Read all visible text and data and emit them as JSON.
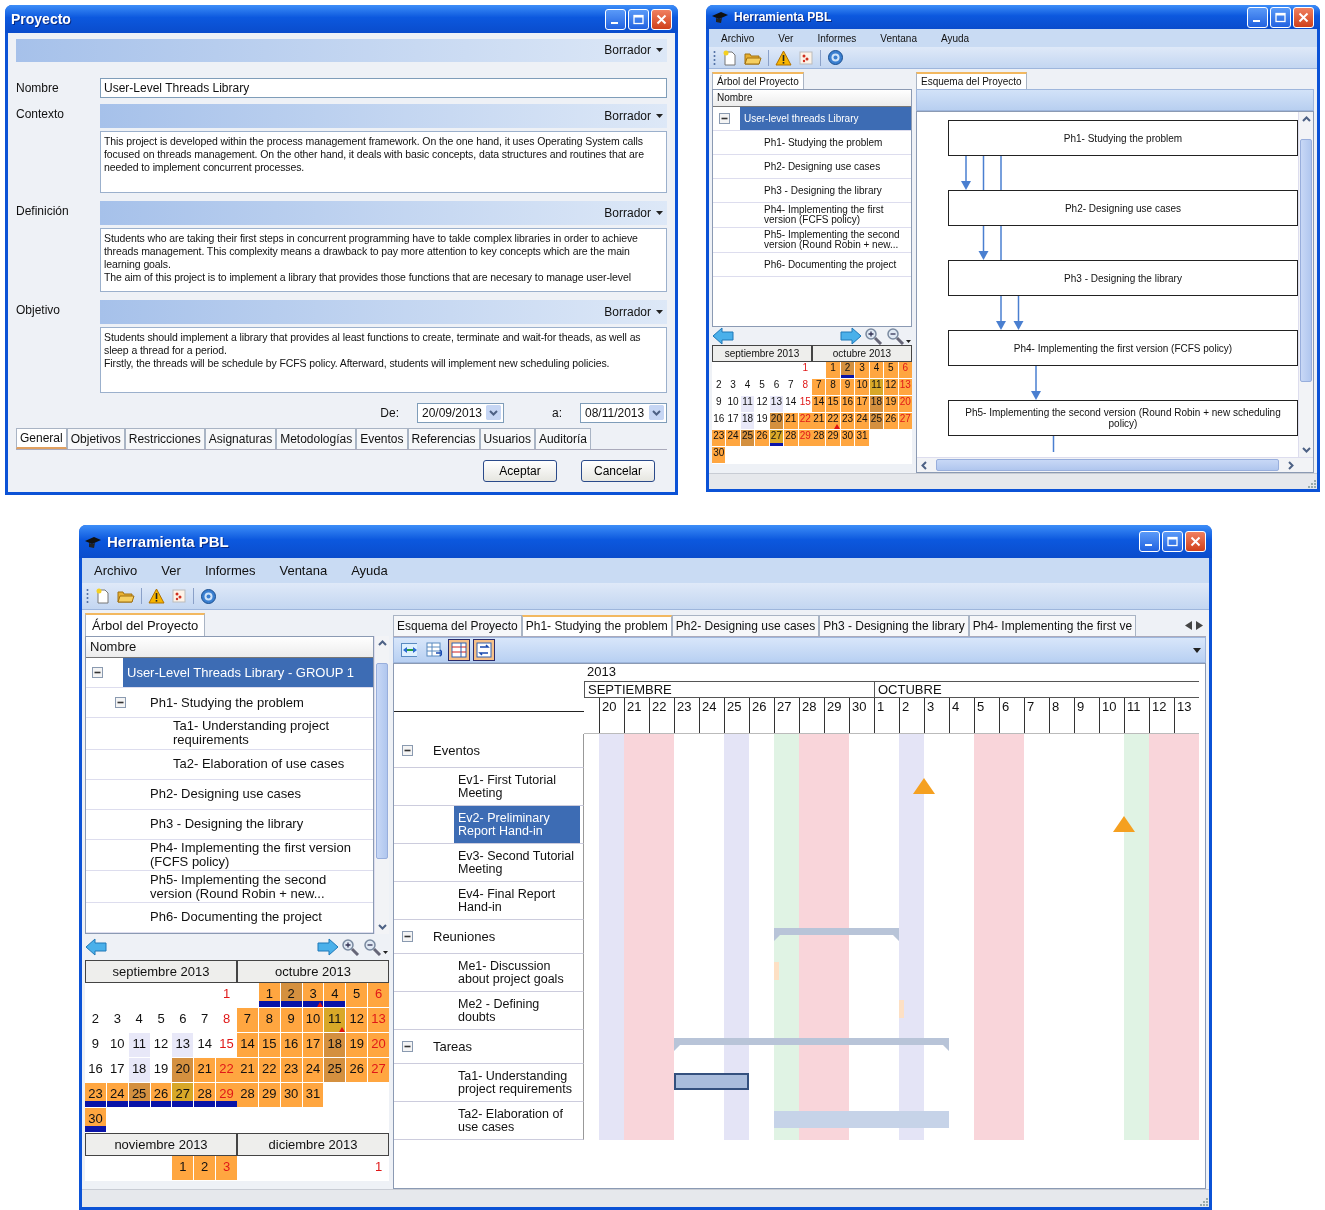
{
  "project_dialog": {
    "title": "Proyecto",
    "status": "Borrador",
    "fields": [
      {
        "kind": "input",
        "label": "Nombre",
        "value": "User-Level Threads Library"
      },
      {
        "kind": "text",
        "label": "Contexto",
        "status": "Borrador",
        "paragraphs": [
          "This project is developed within the process management framework. On the one hand, it uses Operating System calls focused on threads management. On the other hand, it deals with basic concepts, data structures and routines that are needed to implement concurrent processes."
        ]
      },
      {
        "kind": "text",
        "label": "Definición",
        "status": "Borrador",
        "paragraphs": [
          "Students who are taking their first steps in concurrent programming have to takle complex libraries in order to achieve threads management. This complexity means a drawback to pay more attention to key concepts which are the main learning goals.",
          "The aim of this project is to implement a library that provides those functions that are necesary to manage user-level"
        ]
      },
      {
        "kind": "text",
        "label": "Objetivo",
        "status": "Borrador",
        "paragraphs": [
          "Students should implement a library that provides al least functions to create, terminate and wait-for theads, as well as sleep a thread for a period.",
          "Firstly, the threads will be schedule by FCFS policy. Afterward, students will implement new scheduling policies."
        ]
      }
    ],
    "date_from": {
      "label": "De:",
      "value": "20/09/2013"
    },
    "date_to": {
      "label": "a:",
      "value": "08/11/2013"
    },
    "tabs": [
      {
        "label": "General",
        "selected": true
      },
      {
        "label": "Objetivos",
        "selected": false
      },
      {
        "label": "Restricciones",
        "selected": false
      },
      {
        "label": "Asignaturas",
        "selected": false
      },
      {
        "label": "Metodologías",
        "selected": false
      },
      {
        "label": "Eventos",
        "selected": false
      },
      {
        "label": "Referencias",
        "selected": false
      },
      {
        "label": "Usuarios",
        "selected": false
      },
      {
        "label": "Auditoría",
        "selected": false
      }
    ],
    "buttons": [
      "Aceptar",
      "Cancelar"
    ]
  },
  "tool_window": {
    "title": "Herramienta PBL",
    "menu": [
      "Archivo",
      "Ver",
      "Informes",
      "Ventana",
      "Ayuda"
    ],
    "tree_tab": "Árbol del Proyecto",
    "tree_header": "Nombre",
    "tree": [
      {
        "label": "User-level threads Library",
        "selected": true,
        "expanded": true,
        "children": [
          {
            "label": "Ph1-  Studying the problem",
            "selected": false
          },
          {
            "label": "Ph2- Designing use cases",
            "selected": false
          },
          {
            "label": "Ph3 - Designing the library",
            "selected": false
          },
          {
            "label": "Ph4- Implementing the first version (FCFS policy)",
            "selected": false
          },
          {
            "label": "Ph5- Implementing the second version (Round Robin + new...",
            "selected": false
          },
          {
            "label": "Ph6- Documenting the project",
            "selected": false
          }
        ]
      }
    ],
    "calendar": [
      {
        "title": "septiembre 2013",
        "weeks": [
          [
            {
              "kind": "empty"
            },
            {
              "kind": "empty"
            },
            {
              "kind": "empty"
            },
            {
              "kind": "empty"
            },
            {
              "kind": "empty"
            },
            {
              "kind": "empty"
            },
            {
              "day": "1",
              "kind": "sunday",
              "color": "#ffffff",
              "bar": false,
              "flag": false
            }
          ],
          [
            {
              "day": "2",
              "kind": "weekday",
              "color": "#ffffff",
              "bar": false,
              "flag": false
            },
            {
              "day": "3",
              "kind": "weekday",
              "color": "#ffffff",
              "bar": false,
              "flag": false
            },
            {
              "day": "4",
              "kind": "weekday",
              "color": "#ffffff",
              "bar": false,
              "flag": false
            },
            {
              "day": "5",
              "kind": "weekday",
              "color": "#ffffff",
              "bar": false,
              "flag": false
            },
            {
              "day": "6",
              "kind": "weekday",
              "color": "#ffffff",
              "bar": false,
              "flag": false
            },
            {
              "day": "7",
              "kind": "weekday",
              "color": "#ffffff",
              "bar": false,
              "flag": false
            },
            {
              "day": "8",
              "kind": "sunday",
              "color": "#ffffff",
              "bar": false,
              "flag": false
            }
          ],
          [
            {
              "day": "9",
              "kind": "weekday",
              "color": "#ffffff",
              "bar": false,
              "flag": false
            },
            {
              "day": "10",
              "kind": "weekday",
              "color": "#ffffff",
              "bar": false,
              "flag": false
            },
            {
              "day": "11",
              "kind": "weekday",
              "color": "#e8e8f8",
              "bar": false,
              "flag": false
            },
            {
              "day": "12",
              "kind": "weekday",
              "color": "#ffffff",
              "bar": false,
              "flag": false
            },
            {
              "day": "13",
              "kind": "weekday",
              "color": "#e8e8f8",
              "bar": false,
              "flag": false
            },
            {
              "day": "14",
              "kind": "weekday",
              "color": "#ffffff",
              "bar": false,
              "flag": false
            },
            {
              "day": "15",
              "kind": "sunday",
              "color": "#ffffff",
              "bar": false,
              "flag": false
            }
          ],
          [
            {
              "day": "16",
              "kind": "weekday",
              "color": "#ffffff",
              "bar": false,
              "flag": false
            },
            {
              "day": "17",
              "kind": "weekday",
              "color": "#ffffff",
              "bar": false,
              "flag": false
            },
            {
              "day": "18",
              "kind": "weekday",
              "color": "#e8e8f8",
              "bar": false,
              "flag": false
            },
            {
              "day": "19",
              "kind": "weekday",
              "color": "#ffffff",
              "bar": false,
              "flag": false
            },
            {
              "day": "20",
              "kind": "weekday",
              "color": "#d4903f",
              "bar": false,
              "flag": false
            },
            {
              "day": "21",
              "kind": "weekday",
              "color": "#ffa640",
              "bar": false,
              "flag": false
            },
            {
              "day": "22",
              "kind": "sunday",
              "color": "#ffa640",
              "bar": false,
              "flag": false
            }
          ],
          [
            {
              "day": "23",
              "kind": "weekday",
              "color": "#ffa640",
              "bar": false,
              "flag": false
            },
            {
              "day": "24",
              "kind": "weekday",
              "color": "#ffa640",
              "bar": false,
              "flag": false
            },
            {
              "day": "25",
              "kind": "weekday",
              "color": "#d4903f",
              "bar": false,
              "flag": false
            },
            {
              "day": "26",
              "kind": "weekday",
              "color": "#ffa640",
              "bar": false,
              "flag": false
            },
            {
              "day": "27",
              "kind": "weekday",
              "color": "#d8a828",
              "bar": true,
              "flag": false
            },
            {
              "day": "28",
              "kind": "weekday",
              "color": "#ffa640",
              "bar": false,
              "flag": false
            },
            {
              "day": "29",
              "kind": "sunday",
              "color": "#ffa640",
              "bar": false,
              "flag": false
            }
          ],
          [
            {
              "day": "30",
              "kind": "weekday",
              "color": "#ffa640",
              "bar": false,
              "flag": false
            }
          ]
        ]
      },
      {
        "title": "octubre 2013",
        "weeks": [
          [
            {
              "kind": "empty"
            },
            {
              "day": "1",
              "kind": "weekday",
              "color": "#ffa640",
              "bar": false,
              "flag": false
            },
            {
              "day": "2",
              "kind": "weekday",
              "color": "#d4903f",
              "bar": true,
              "flag": false
            },
            {
              "day": "3",
              "kind": "weekday",
              "color": "#ffa640",
              "bar": false,
              "flag": false
            },
            {
              "day": "4",
              "kind": "weekday",
              "color": "#ffa640",
              "bar": false,
              "flag": false
            },
            {
              "day": "5",
              "kind": "weekday",
              "color": "#ffa640",
              "bar": false,
              "flag": false
            },
            {
              "day": "6",
              "kind": "sunday",
              "color": "#ffa640",
              "bar": false,
              "flag": false
            }
          ],
          [
            {
              "day": "7",
              "kind": "weekday",
              "color": "#ffa640",
              "bar": false,
              "flag": false
            },
            {
              "day": "8",
              "kind": "weekday",
              "color": "#ffa640",
              "bar": false,
              "flag": false
            },
            {
              "day": "9",
              "kind": "weekday",
              "color": "#ffa640",
              "bar": false,
              "flag": false
            },
            {
              "day": "10",
              "kind": "weekday",
              "color": "#ffa640",
              "bar": false,
              "flag": false
            },
            {
              "day": "11",
              "kind": "weekday",
              "color": "#d8a828",
              "bar": false,
              "flag": false
            },
            {
              "day": "12",
              "kind": "weekday",
              "color": "#ffa640",
              "bar": false,
              "flag": false
            },
            {
              "day": "13",
              "kind": "sunday",
              "color": "#ffa640",
              "bar": false,
              "flag": false
            }
          ],
          [
            {
              "day": "14",
              "kind": "weekday",
              "color": "#ffa640",
              "bar": false,
              "flag": false
            },
            {
              "day": "15",
              "kind": "weekday",
              "color": "#ffa640",
              "bar": false,
              "flag": false
            },
            {
              "day": "16",
              "kind": "weekday",
              "color": "#ffa640",
              "bar": false,
              "flag": false
            },
            {
              "day": "17",
              "kind": "weekday",
              "color": "#ffa640",
              "bar": false,
              "flag": false
            },
            {
              "day": "18",
              "kind": "weekday",
              "color": "#d4903f",
              "bar": false,
              "flag": false
            },
            {
              "day": "19",
              "kind": "weekday",
              "color": "#ffa640",
              "bar": false,
              "flag": false
            },
            {
              "day": "20",
              "kind": "sunday",
              "color": "#ffa640",
              "bar": false,
              "flag": false
            }
          ],
          [
            {
              "day": "21",
              "kind": "weekday",
              "color": "#ffa640",
              "bar": false,
              "flag": false
            },
            {
              "day": "22",
              "kind": "weekday",
              "color": "#ffa640",
              "bar": false,
              "flag": true
            },
            {
              "day": "23",
              "kind": "weekday",
              "color": "#ffa640",
              "bar": false,
              "flag": false
            },
            {
              "day": "24",
              "kind": "weekday",
              "color": "#ffa640",
              "bar": false,
              "flag": false
            },
            {
              "day": "25",
              "kind": "weekday",
              "color": "#d4903f",
              "bar": false,
              "flag": false
            },
            {
              "day": "26",
              "kind": "weekday",
              "color": "#ffa640",
              "bar": false,
              "flag": false
            },
            {
              "day": "27",
              "kind": "sunday",
              "color": "#ffa640",
              "bar": false,
              "flag": false
            }
          ],
          [
            {
              "day": "28",
              "kind": "weekday",
              "color": "#ffa640",
              "bar": false,
              "flag": false
            },
            {
              "day": "29",
              "kind": "weekday",
              "color": "#ffa640",
              "bar": false,
              "flag": false
            },
            {
              "day": "30",
              "kind": "weekday",
              "color": "#ffa640",
              "bar": false,
              "flag": false
            },
            {
              "day": "31",
              "kind": "weekday",
              "color": "#ffa640",
              "bar": false,
              "flag": false
            }
          ]
        ]
      }
    ],
    "diagram_tab": "Esquema del Proyecto",
    "diagram": {
      "nodes": [
        "Ph1-  Studying the problem",
        "Ph2- Designing use cases",
        "Ph3 - Designing the library",
        "Ph4- Implementing the first version (FCFS policy)",
        "Ph5- Implementing the second version (Round Robin + new scheduling policy)"
      ]
    }
  },
  "main_window": {
    "title": "Herramienta PBL",
    "menu": [
      "Archivo",
      "Ver",
      "Informes",
      "Ventana",
      "Ayuda"
    ],
    "tree_tab": "Árbol del Proyecto",
    "tree_header": "Nombre",
    "tree": [
      {
        "label": "User-Level Threads Library - GROUP 1",
        "selected": true,
        "expanded": true,
        "children": [
          {
            "label": "Ph1-  Studying the problem",
            "selected": false,
            "expanded": true,
            "children": [
              {
                "label": "Ta1- Understanding project requirements",
                "selected": false
              },
              {
                "label": "Ta2- Elaboration of use cases",
                "selected": false
              }
            ]
          },
          {
            "label": "Ph2- Designing use cases",
            "selected": false
          },
          {
            "label": "Ph3 - Designing the library",
            "selected": false
          },
          {
            "label": "Ph4- Implementing the first version (FCFS policy)",
            "selected": false
          },
          {
            "label": "Ph5- Implementing the second version (Round Robin + new...",
            "selected": false
          },
          {
            "label": "Ph6- Documenting the project",
            "selected": false
          }
        ]
      }
    ],
    "calendar": [
      {
        "title": "septiembre 2013",
        "weeks": [
          [
            {
              "kind": "empty"
            },
            {
              "kind": "empty"
            },
            {
              "kind": "empty"
            },
            {
              "kind": "empty"
            },
            {
              "kind": "empty"
            },
            {
              "kind": "empty"
            },
            {
              "day": "1",
              "kind": "sunday",
              "color": "#ffffff",
              "bar": false,
              "flag": false
            }
          ],
          [
            {
              "day": "2",
              "kind": "weekday",
              "color": "#ffffff",
              "bar": false,
              "flag": false
            },
            {
              "day": "3",
              "kind": "weekday",
              "color": "#ffffff",
              "bar": false,
              "flag": false
            },
            {
              "day": "4",
              "kind": "weekday",
              "color": "#ffffff",
              "bar": false,
              "flag": false
            },
            {
              "day": "5",
              "kind": "weekday",
              "color": "#ffffff",
              "bar": false,
              "flag": false
            },
            {
              "day": "6",
              "kind": "weekday",
              "color": "#ffffff",
              "bar": false,
              "flag": false
            },
            {
              "day": "7",
              "kind": "weekday",
              "color": "#ffffff",
              "bar": false,
              "flag": false
            },
            {
              "day": "8",
              "kind": "sunday",
              "color": "#ffffff",
              "bar": false,
              "flag": false
            }
          ],
          [
            {
              "day": "9",
              "kind": "weekday",
              "color": "#ffffff",
              "bar": false,
              "flag": false
            },
            {
              "day": "10",
              "kind": "weekday",
              "color": "#ffffff",
              "bar": false,
              "flag": false
            },
            {
              "day": "11",
              "kind": "weekday",
              "color": "#e8e8f8",
              "bar": false,
              "flag": false
            },
            {
              "day": "12",
              "kind": "weekday",
              "color": "#ffffff",
              "bar": false,
              "flag": false
            },
            {
              "day": "13",
              "kind": "weekday",
              "color": "#e8e8f8",
              "bar": false,
              "flag": false
            },
            {
              "day": "14",
              "kind": "weekday",
              "color": "#ffffff",
              "bar": false,
              "flag": false
            },
            {
              "day": "15",
              "kind": "sunday",
              "color": "#ffffff",
              "bar": false,
              "flag": false
            }
          ],
          [
            {
              "day": "16",
              "kind": "weekday",
              "color": "#ffffff",
              "bar": false,
              "flag": false
            },
            {
              "day": "17",
              "kind": "weekday",
              "color": "#ffffff",
              "bar": false,
              "flag": false
            },
            {
              "day": "18",
              "kind": "weekday",
              "color": "#e8e8f8",
              "bar": false,
              "flag": false
            },
            {
              "day": "19",
              "kind": "weekday",
              "color": "#ffffff",
              "bar": false,
              "flag": false
            },
            {
              "day": "20",
              "kind": "weekday",
              "color": "#d4903f",
              "bar": false,
              "flag": false
            },
            {
              "day": "21",
              "kind": "weekday",
              "color": "#ffa640",
              "bar": false,
              "flag": false
            },
            {
              "day": "22",
              "kind": "sunday",
              "color": "#ffa640",
              "bar": false,
              "flag": false
            }
          ],
          [
            {
              "day": "23",
              "kind": "weekday",
              "color": "#ffa640",
              "bar": true,
              "flag": false
            },
            {
              "day": "24",
              "kind": "weekday",
              "color": "#ffa640",
              "bar": true,
              "flag": false
            },
            {
              "day": "25",
              "kind": "weekday",
              "color": "#d4903f",
              "bar": true,
              "flag": false
            },
            {
              "day": "26",
              "kind": "weekday",
              "color": "#ffa640",
              "bar": true,
              "flag": false
            },
            {
              "day": "27",
              "kind": "weekday",
              "color": "#d8a828",
              "bar": true,
              "flag": false
            },
            {
              "day": "28",
              "kind": "weekday",
              "color": "#ffa640",
              "bar": true,
              "flag": false
            },
            {
              "day": "29",
              "kind": "sunday",
              "color": "#ffa640",
              "bar": true,
              "flag": false
            }
          ],
          [
            {
              "day": "30",
              "kind": "weekday",
              "color": "#ffa640",
              "bar": true,
              "flag": false
            }
          ]
        ]
      },
      {
        "title": "octubre 2013",
        "weeks": [
          [
            {
              "kind": "empty"
            },
            {
              "day": "1",
              "kind": "weekday",
              "color": "#ffa640",
              "bar": true,
              "flag": false
            },
            {
              "day": "2",
              "kind": "weekday",
              "color": "#d4903f",
              "bar": true,
              "flag": false
            },
            {
              "day": "3",
              "kind": "weekday",
              "color": "#ffa640",
              "bar": true,
              "flag": true
            },
            {
              "day": "4",
              "kind": "weekday",
              "color": "#ffa640",
              "bar": true,
              "flag": false
            },
            {
              "day": "5",
              "kind": "weekday",
              "color": "#ffa640",
              "bar": false,
              "flag": false
            },
            {
              "day": "6",
              "kind": "sunday",
              "color": "#ffa640",
              "bar": false,
              "flag": false
            }
          ],
          [
            {
              "day": "7",
              "kind": "weekday",
              "color": "#ffa640",
              "bar": false,
              "flag": false
            },
            {
              "day": "8",
              "kind": "weekday",
              "color": "#ffa640",
              "bar": false,
              "flag": false
            },
            {
              "day": "9",
              "kind": "weekday",
              "color": "#ffa640",
              "bar": false,
              "flag": false
            },
            {
              "day": "10",
              "kind": "weekday",
              "color": "#ffa640",
              "bar": false,
              "flag": false
            },
            {
              "day": "11",
              "kind": "weekday",
              "color": "#d8a828",
              "bar": false,
              "flag": true
            },
            {
              "day": "12",
              "kind": "weekday",
              "color": "#ffa640",
              "bar": false,
              "flag": false
            },
            {
              "day": "13",
              "kind": "sunday",
              "color": "#ffa640",
              "bar": false,
              "flag": false
            }
          ],
          [
            {
              "day": "14",
              "kind": "weekday",
              "color": "#ffa640",
              "bar": false,
              "flag": false
            },
            {
              "day": "15",
              "kind": "weekday",
              "color": "#ffa640",
              "bar": false,
              "flag": false
            },
            {
              "day": "16",
              "kind": "weekday",
              "color": "#ffa640",
              "bar": false,
              "flag": false
            },
            {
              "day": "17",
              "kind": "weekday",
              "color": "#ffa640",
              "bar": false,
              "flag": false
            },
            {
              "day": "18",
              "kind": "weekday",
              "color": "#d4903f",
              "bar": false,
              "flag": false
            },
            {
              "day": "19",
              "kind": "weekday",
              "color": "#ffa640",
              "bar": false,
              "flag": false
            },
            {
              "day": "20",
              "kind": "sunday",
              "color": "#ffa640",
              "bar": false,
              "flag": false
            }
          ],
          [
            {
              "day": "21",
              "kind": "weekday",
              "color": "#ffa640",
              "bar": false,
              "flag": false
            },
            {
              "day": "22",
              "kind": "weekday",
              "color": "#ffa640",
              "bar": false,
              "flag": false
            },
            {
              "day": "23",
              "kind": "weekday",
              "color": "#ffa640",
              "bar": false,
              "flag": false
            },
            {
              "day": "24",
              "kind": "weekday",
              "color": "#ffa640",
              "bar": false,
              "flag": false
            },
            {
              "day": "25",
              "kind": "weekday",
              "color": "#d4903f",
              "bar": false,
              "flag": false
            },
            {
              "day": "26",
              "kind": "weekday",
              "color": "#ffa640",
              "bar": false,
              "flag": false
            },
            {
              "day": "27",
              "kind": "sunday",
              "color": "#ffa640",
              "bar": false,
              "flag": false
            }
          ],
          [
            {
              "day": "28",
              "kind": "weekday",
              "color": "#ffa640",
              "bar": false,
              "flag": false
            },
            {
              "day": "29",
              "kind": "weekday",
              "color": "#ffa640",
              "bar": false,
              "flag": false
            },
            {
              "day": "30",
              "kind": "weekday",
              "color": "#ffa640",
              "bar": false,
              "flag": false
            },
            {
              "day": "31",
              "kind": "weekday",
              "color": "#ffa640",
              "bar": false,
              "flag": false
            }
          ]
        ]
      },
      {
        "title": "noviembre 2013",
        "weeks": [
          [
            {
              "kind": "empty"
            },
            {
              "kind": "empty"
            },
            {
              "kind": "empty"
            },
            {
              "kind": "empty"
            },
            {
              "day": "1",
              "kind": "weekday",
              "color": "#ffa640",
              "bar": false,
              "flag": false
            },
            {
              "day": "2",
              "kind": "weekday",
              "color": "#ffa640",
              "bar": false,
              "flag": false
            },
            {
              "day": "3",
              "kind": "sunday",
              "color": "#ffa640",
              "bar": false,
              "flag": false
            }
          ]
        ]
      },
      {
        "title": "diciembre 2013",
        "weeks": [
          [
            {
              "kind": "empty"
            },
            {
              "kind": "empty"
            },
            {
              "kind": "empty"
            },
            {
              "kind": "empty"
            },
            {
              "kind": "empty"
            },
            {
              "kind": "empty"
            },
            {
              "day": "1",
              "kind": "sunday",
              "color": "#ffffff",
              "bar": false,
              "flag": false
            }
          ]
        ]
      }
    ],
    "tabs": [
      {
        "label": "Esquema del Proyecto",
        "selected": false
      },
      {
        "label": "Ph1-  Studying the problem",
        "selected": true
      },
      {
        "label": "Ph2- Designing use cases",
        "selected": false
      },
      {
        "label": "Ph3 - Designing the library",
        "selected": false
      },
      {
        "label": "Ph4- Implementing the first ve",
        "selected": false
      }
    ],
    "gantt_toolbar": [
      {
        "kind": "expand",
        "pressed": false
      },
      {
        "kind": "export",
        "pressed": false
      },
      {
        "kind": "columns",
        "pressed": true
      },
      {
        "kind": "swap",
        "pressed": true
      }
    ],
    "gantt": {
      "year": "2013",
      "months": [
        {
          "label": "SEPTIEMBRE",
          "days": [
            {
              "label": "20",
              "color": "#e4e4f6"
            },
            {
              "label": "21",
              "color": "#f9d5da"
            },
            {
              "label": "22",
              "color": "#f9d5da"
            },
            {
              "label": "23",
              "color": "#ffffff"
            },
            {
              "label": "24",
              "color": "#ffffff"
            },
            {
              "label": "25",
              "color": "#e4e4f6"
            },
            {
              "label": "26",
              "color": "#ffffff"
            },
            {
              "label": "27",
              "color": "#e0f3e4"
            },
            {
              "label": "28",
              "color": "#f9d5da"
            },
            {
              "label": "29",
              "color": "#f9d5da"
            },
            {
              "label": "30",
              "color": "#ffffff"
            }
          ]
        },
        {
          "label": "OCTUBRE",
          "days": [
            {
              "label": "1",
              "color": "#ffffff"
            },
            {
              "label": "2",
              "color": "#e4e4f6"
            },
            {
              "label": "3",
              "color": "#ffffff"
            },
            {
              "label": "4",
              "color": "#ffffff"
            },
            {
              "label": "5",
              "color": "#f9d5da"
            },
            {
              "label": "6",
              "color": "#f9d5da"
            },
            {
              "label": "7",
              "color": "#ffffff"
            },
            {
              "label": "8",
              "color": "#ffffff"
            },
            {
              "label": "9",
              "color": "#ffffff"
            },
            {
              "label": "10",
              "color": "#ffffff"
            },
            {
              "label": "11",
              "color": "#e0f3e4"
            },
            {
              "label": "12",
              "color": "#f9d5da"
            },
            {
              "label": "13",
              "color": "#f9d5da"
            }
          ]
        }
      ],
      "rows": [
        {
          "kind": "group",
          "label": "Eventos",
          "expanded": true
        },
        {
          "kind": "item",
          "label": "Ev1- First Tutorial Meeting",
          "selected": false,
          "bar": {
            "kind": "milestone"
          }
        },
        {
          "kind": "item",
          "label": "Ev2- Preliminary Report Hand-in",
          "selected": true,
          "bar": {
            "kind": "milestone"
          }
        },
        {
          "kind": "item",
          "label": "Ev3- Second Tutorial Meeting",
          "selected": false
        },
        {
          "kind": "item",
          "label": "Ev4- Final Report Hand-in",
          "selected": false
        },
        {
          "kind": "group",
          "label": "Reuniones",
          "expanded": true,
          "bar": {
            "kind": "meeting_summary"
          }
        },
        {
          "kind": "item",
          "label": "Me1- Discussion about project goals",
          "selected": false,
          "bar": {
            "kind": "meeting"
          }
        },
        {
          "kind": "item",
          "label": "Me2 - Defining doubts",
          "selected": false,
          "bar": {
            "kind": "meeting"
          }
        },
        {
          "kind": "group",
          "label": "Tareas",
          "expanded": true,
          "bar": {
            "kind": "task_summary"
          }
        },
        {
          "kind": "item",
          "label": "Ta1- Understanding project requirements",
          "selected": false,
          "bar": {
            "kind": "task",
            "highlighted": true
          }
        },
        {
          "kind": "item",
          "label": "Ta2- Elaboration of use cases",
          "selected": false,
          "bar": {
            "kind": "task",
            "highlighted": false
          }
        }
      ]
    }
  }
}
